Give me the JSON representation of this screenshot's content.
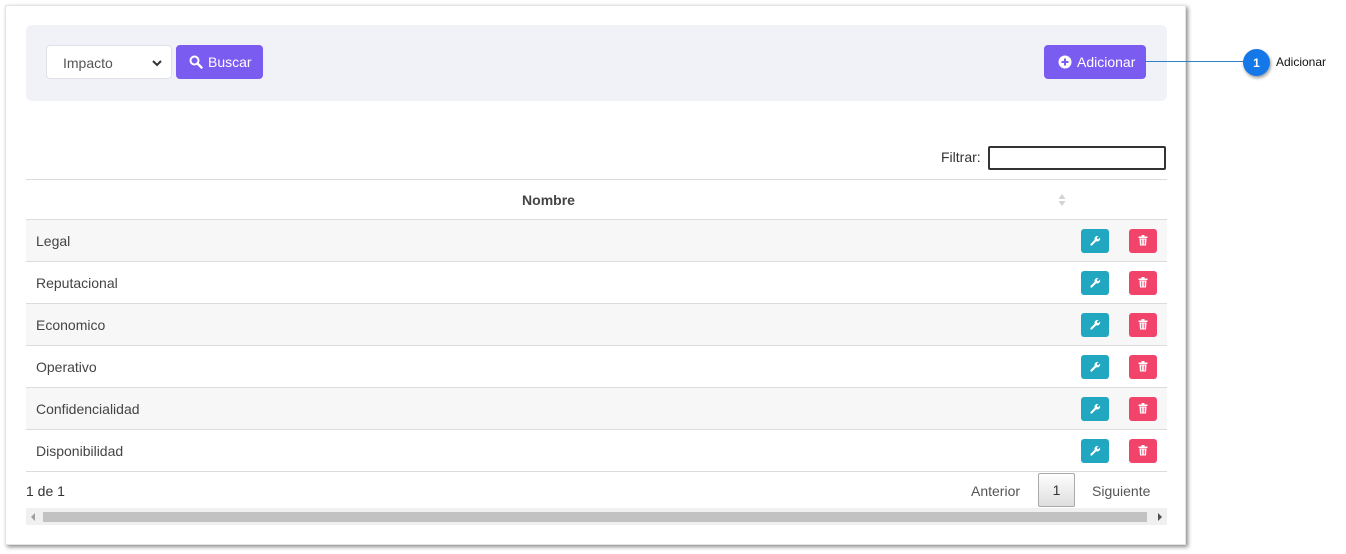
{
  "toolbar": {
    "select_value": "Impacto",
    "search_label": "Buscar",
    "add_label": "Adicionar"
  },
  "filter": {
    "label": "Filtrar:",
    "value": ""
  },
  "table": {
    "header": "Nombre",
    "rows": [
      {
        "name": "Legal"
      },
      {
        "name": "Reputacional"
      },
      {
        "name": "Economico"
      },
      {
        "name": "Operativo"
      },
      {
        "name": "Confidencialidad"
      },
      {
        "name": "Disponibilidad"
      }
    ]
  },
  "pagination": {
    "info": "1 de 1",
    "prev_label": "Anterior",
    "current_page": "1",
    "next_label": "Siguiente"
  },
  "callout": {
    "number": "1",
    "label": "Adicionar"
  },
  "colors": {
    "primary": "#7b5cf0",
    "edit": "#22a7c0",
    "delete": "#f2436b",
    "callout": "#1478e8"
  },
  "icons": {
    "search": "search-icon",
    "add": "plus-circle-icon",
    "edit": "wrench-icon",
    "delete": "trash-icon",
    "dropdown": "chevron-down-icon",
    "sort": "sort-icon"
  }
}
